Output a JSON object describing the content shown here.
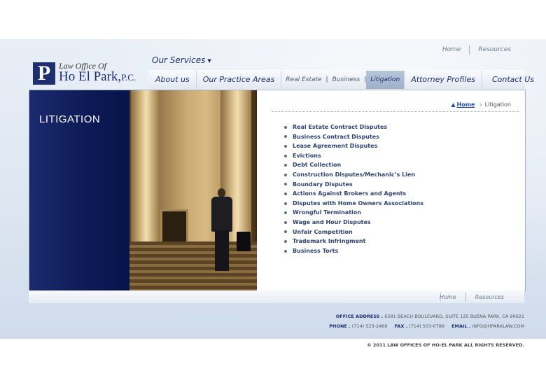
{
  "logo": {
    "letter": "P",
    "small": "Law Office Of",
    "big": "Ho El Park,",
    "suffix": "P.C."
  },
  "header": {
    "our_services": "Our Services",
    "toplinks": [
      "Home",
      "Resources"
    ]
  },
  "nav": {
    "about": "About us",
    "practice": "Our Practice Areas",
    "sub": [
      "Real Estate",
      "Business",
      "Litigation"
    ],
    "pipe": "|",
    "attorney": "Attorney Profiles",
    "contact": "Contact Us"
  },
  "page": {
    "title": "LITIGATION"
  },
  "breadcrumb": {
    "home": "Home",
    "current": "Litigation"
  },
  "list": [
    "Real Estate Contract Disputes",
    "Business Contract Disputes",
    "Lease Agreement Disputes",
    "Evictions",
    "Debt Collection",
    "Construction Disputes/Mechanic’s Lien",
    "Boundary Disputes",
    "Actions Against Brokers and Agents",
    "Disputes with Home Owners Associations",
    "Wrongful Termination",
    "Wage and Hour Disputes",
    "Unfair Competition",
    "Trademark Infringment",
    "Business Torts"
  ],
  "footer": {
    "links": [
      "Home",
      "Resources"
    ],
    "address_label": "OFFICE ADDRESS .",
    "address": "6281 BEACH BOULEVARD, SUITE 125 BUENA PARK, CA 90621",
    "phone_label": "PHONE .",
    "phone": "(714) 523-2466",
    "fax_label": "FAX .",
    "fax": "(714) 503-0788",
    "email_label": "EMAIL .",
    "email": "INFO@HPARKLAW.COM",
    "copyright": "© 2011 LAW OFFICES OF HO-EL PARK ALL RIGHTS RESERVED."
  },
  "colors": {
    "brand": "#1d2f6e",
    "link": "#1f4fa8"
  }
}
